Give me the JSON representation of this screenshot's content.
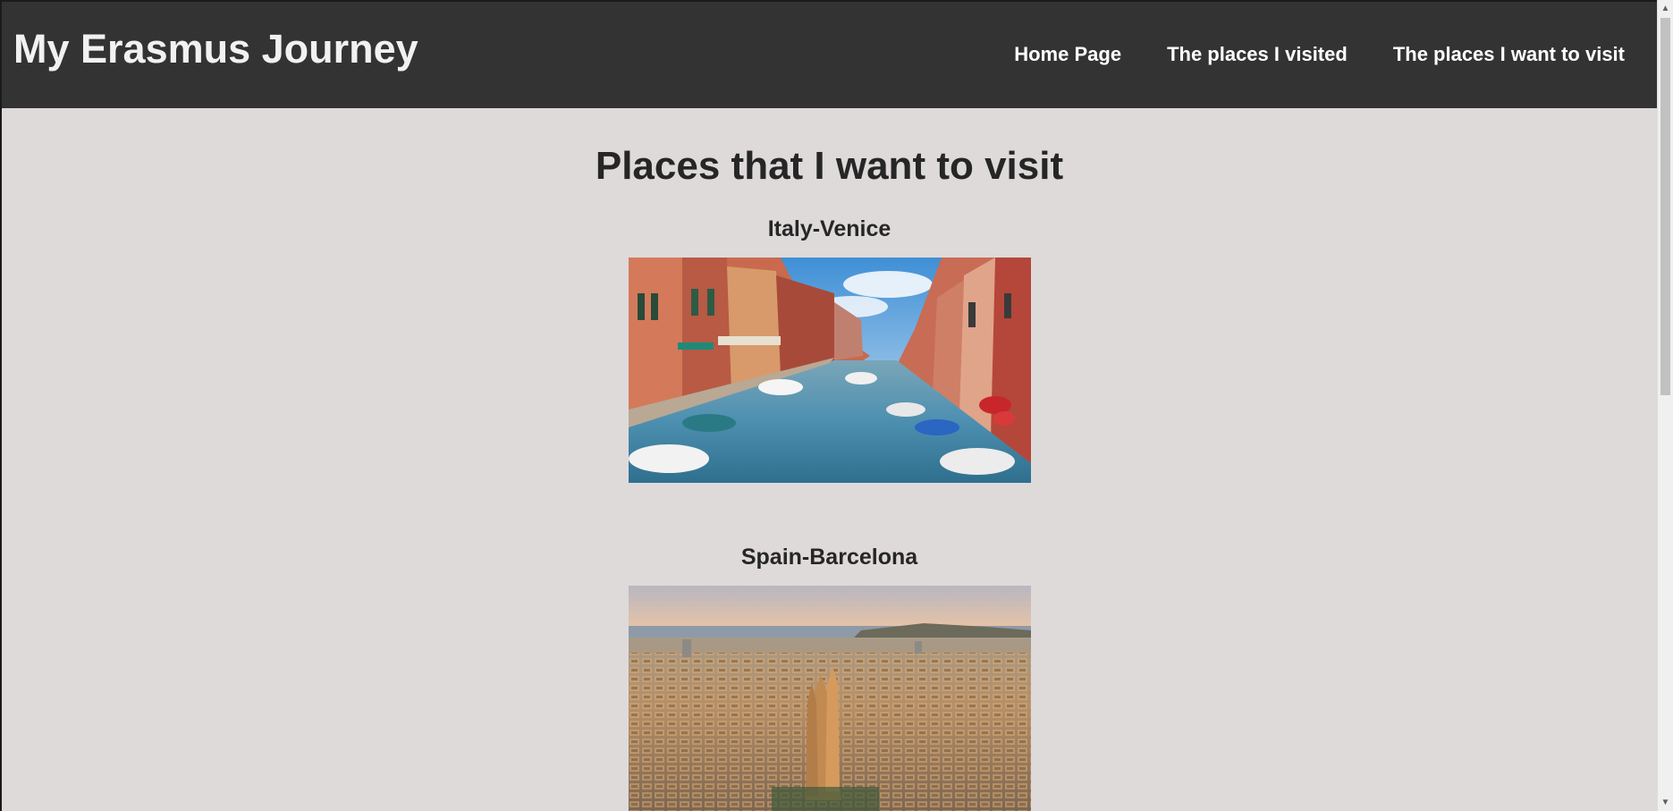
{
  "header": {
    "site_title": "My Erasmus Journey",
    "nav": [
      {
        "label": "Home Page"
      },
      {
        "label": "The places I visited"
      },
      {
        "label": "The places I want to visit"
      }
    ]
  },
  "main": {
    "heading": "Places that I want to visit",
    "places": [
      {
        "title": "Italy-Venice"
      },
      {
        "title": "Spain-Barcelona"
      }
    ]
  },
  "colors": {
    "header_bg": "#333333",
    "page_bg": "#dedada",
    "text": "#262626"
  }
}
